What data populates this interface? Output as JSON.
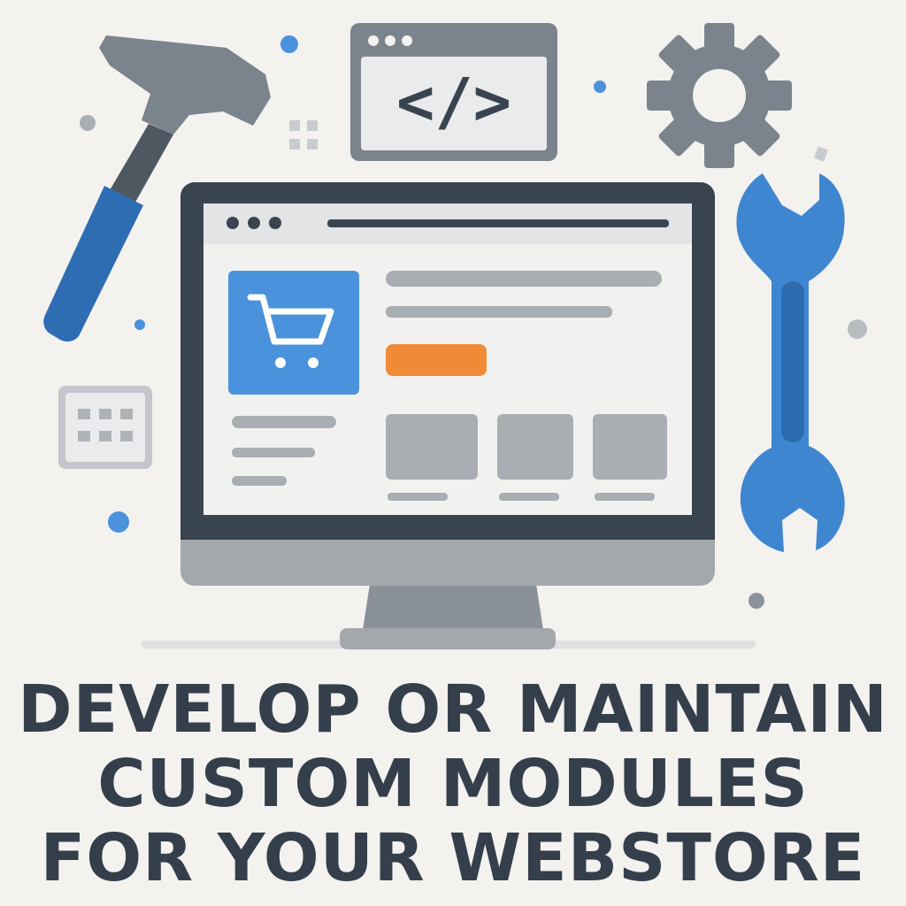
{
  "colors": {
    "background": "#f3f2ef",
    "dark": "#3a444f",
    "gray": "#7a828b",
    "light_gray": "#a9aeb3",
    "blue": "#3f86d0",
    "blue_dark": "#2c6cae",
    "orange": "#f18a37",
    "text": "#343f4b"
  },
  "icons": {
    "hammer": "hammer-icon",
    "code_window": "code-window-icon",
    "gear": "gear-icon",
    "wrench": "wrench-icon",
    "monitor": "monitor-icon",
    "cart": "shopping-cart-icon",
    "grid": "grid-icon"
  },
  "code_window": {
    "symbol": "</>"
  },
  "headline": {
    "line1": "DEVELOP OR MAINTAIN",
    "line2": "CUSTOM MODULES",
    "line3": "FOR YOUR WEBSTORE"
  }
}
